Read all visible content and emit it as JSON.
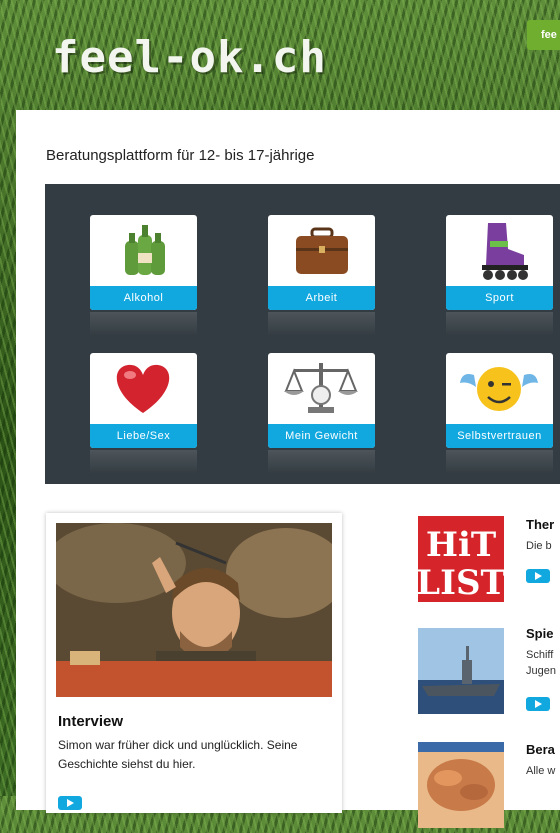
{
  "header": {
    "logo": "feel-ok.ch",
    "tab_label": "fee"
  },
  "tagline": "Beratungsplattform für 12- bis 17-jährige",
  "topics": [
    {
      "label": "Alkohol",
      "icon": "bottles-icon"
    },
    {
      "label": "Arbeit",
      "icon": "briefcase-icon"
    },
    {
      "label": "Sport",
      "icon": "inline-skate-icon"
    },
    {
      "label": "Liebe/Sex",
      "icon": "heart-icon"
    },
    {
      "label": "Mein Gewicht",
      "icon": "scale-icon"
    },
    {
      "label": "Selbstvertrauen",
      "icon": "winking-smiley-icon"
    }
  ],
  "interview": {
    "title": "Interview",
    "text": "Simon war früher dick und unglücklich. Seine Geschichte siehst du hier."
  },
  "news": [
    {
      "title": "Ther",
      "text": [
        "Die b"
      ],
      "thumb_line1": "HiT",
      "thumb_line2": "LIST"
    },
    {
      "title": "Spie",
      "text": [
        "Schiff",
        "Jugen"
      ]
    },
    {
      "title": "Bera",
      "text": [
        "Alle w"
      ]
    }
  ],
  "colors": {
    "accent": "#11a8df",
    "panel": "#333c42",
    "tab": "#6fae2e",
    "hitlist_red": "#d6252a"
  }
}
